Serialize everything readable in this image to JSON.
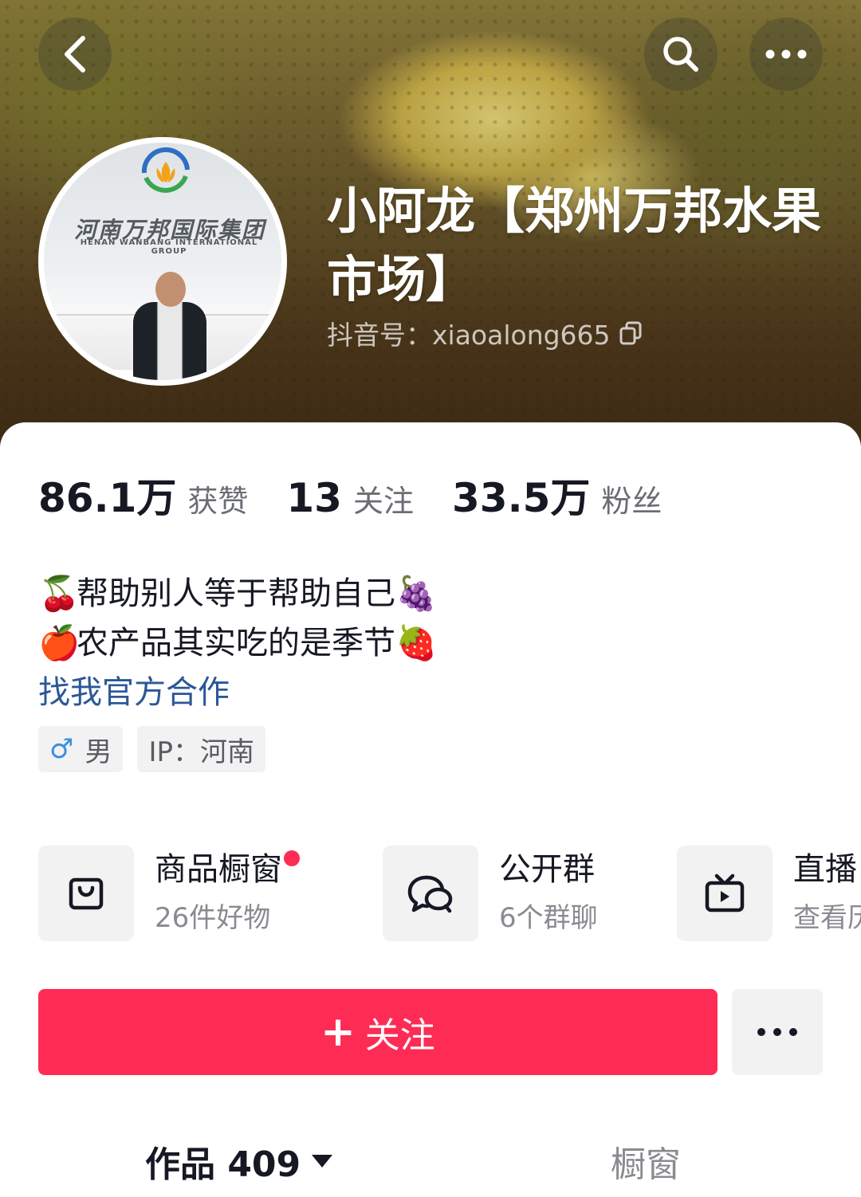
{
  "header": {
    "profile_name": "小阿龙【郑州万邦水果市场】",
    "douyin_id_label": "抖音号：xiaoalong665",
    "avatar_sign_text": "河南万邦国际集团",
    "avatar_sign_subtext": "HENAN WANBANG INTERNATIONAL GROUP",
    "icons": {
      "back": "chevron-left-icon",
      "search": "search-icon",
      "more": "more-dots-icon",
      "copy": "copy-icon"
    }
  },
  "stats": [
    {
      "value": "86.1万",
      "label": "获赞"
    },
    {
      "value": "13",
      "label": "关注"
    },
    {
      "value": "33.5万",
      "label": "粉丝"
    }
  ],
  "bio": {
    "line1_emoji_left": "🍒",
    "line1_text": "帮助别人等于帮助自己",
    "line1_emoji_right": "🍇",
    "line2_emoji_left": "🍎",
    "line2_text": "农产品其实吃的是季节",
    "line2_emoji_right": "🍓",
    "link_text": "找我官方合作"
  },
  "tags": {
    "gender_symbol": "♂",
    "gender": "男",
    "ip": "IP：河南"
  },
  "features": [
    {
      "title": "商品橱窗",
      "subtitle": "26件好物",
      "icon": "shopping-bag-icon",
      "has_dot": true
    },
    {
      "title": "公开群",
      "subtitle": "6个群聊",
      "icon": "chat-bubbles-icon",
      "has_dot": false
    },
    {
      "title": "直播",
      "subtitle": "查看历",
      "icon": "tv-play-icon",
      "has_dot": false
    }
  ],
  "actions": {
    "follow_plus": "+",
    "follow_label": "关注",
    "more_icon": "more-dots-icon"
  },
  "tabs": {
    "works_label": "作品 409",
    "window_label": "橱窗"
  },
  "colors": {
    "accent": "#fe2c55",
    "link": "#2b5797",
    "muted_text": "#8a8b91",
    "chip_bg": "#f2f2f3"
  }
}
